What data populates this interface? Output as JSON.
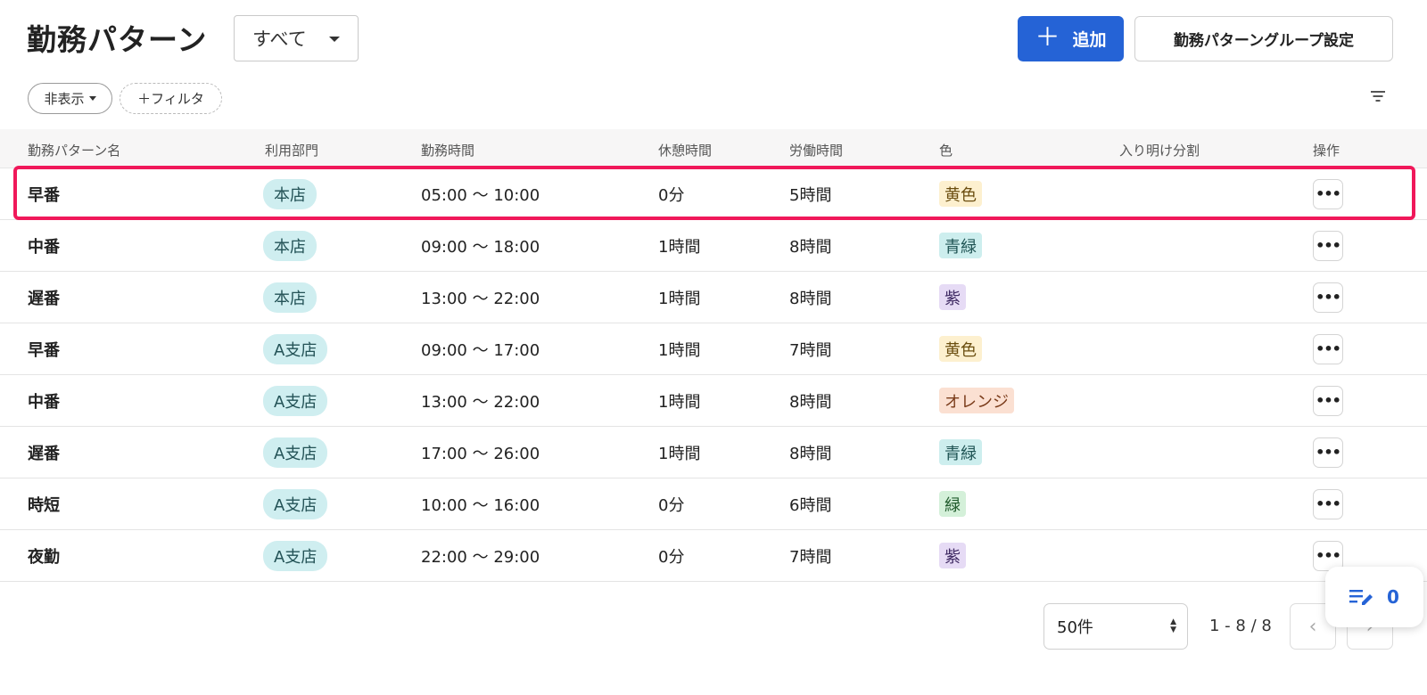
{
  "header": {
    "title": "勤務パターン",
    "scope_select": "すべて",
    "add_button": "追加",
    "group_settings_button": "勤務パターングループ設定"
  },
  "filters": {
    "hidden_chip": "非表示",
    "add_filter_chip": "＋フィルタ"
  },
  "table": {
    "columns": [
      "勤務パターン名",
      "利用部門",
      "勤務時間",
      "休憩時間",
      "労働時間",
      "色",
      "入り明け分割",
      "操作"
    ],
    "rows": [
      {
        "name": "早番",
        "dept": "本店",
        "hours": "05:00 〜 10:00",
        "break": "0分",
        "work": "5時間",
        "color": "黄色",
        "color_hex": "#fdf0cf",
        "color_text": "#6b4e10",
        "split": ""
      },
      {
        "name": "中番",
        "dept": "本店",
        "hours": "09:00 〜 18:00",
        "break": "1時間",
        "work": "8時間",
        "color": "青緑",
        "color_hex": "#cdeeee",
        "color_text": "#1f5454",
        "split": ""
      },
      {
        "name": "遅番",
        "dept": "本店",
        "hours": "13:00 〜 22:00",
        "break": "1時間",
        "work": "8時間",
        "color": "紫",
        "color_hex": "#e6dbf5",
        "color_text": "#3f2a63",
        "split": ""
      },
      {
        "name": "早番",
        "dept": "A支店",
        "hours": "09:00 〜 17:00",
        "break": "1時間",
        "work": "7時間",
        "color": "黄色",
        "color_hex": "#fdf0cf",
        "color_text": "#6b4e10",
        "split": ""
      },
      {
        "name": "中番",
        "dept": "A支店",
        "hours": "13:00 〜 22:00",
        "break": "1時間",
        "work": "8時間",
        "color": "オレンジ",
        "color_hex": "#fbe0d2",
        "color_text": "#7a3b1a",
        "split": ""
      },
      {
        "name": "遅番",
        "dept": "A支店",
        "hours": "17:00 〜 26:00",
        "break": "1時間",
        "work": "8時間",
        "color": "青緑",
        "color_hex": "#cdeeee",
        "color_text": "#1f5454",
        "split": ""
      },
      {
        "name": "時短",
        "dept": "A支店",
        "hours": "10:00 〜 16:00",
        "break": "0分",
        "work": "6時間",
        "color": "緑",
        "color_hex": "#d4f0d9",
        "color_text": "#1f5a2b",
        "split": ""
      },
      {
        "name": "夜勤",
        "dept": "A支店",
        "hours": "22:00 〜 29:00",
        "break": "0分",
        "work": "7時間",
        "color": "紫",
        "color_hex": "#e6dbf5",
        "color_text": "#3f2a63",
        "split": ""
      }
    ],
    "more_label": "•••"
  },
  "pager": {
    "per_page": "50件",
    "range": "1 - 8 / 8"
  },
  "fab": {
    "count": "0"
  },
  "colors": {
    "accent": "#2563d6",
    "highlight": "#f0185a"
  }
}
